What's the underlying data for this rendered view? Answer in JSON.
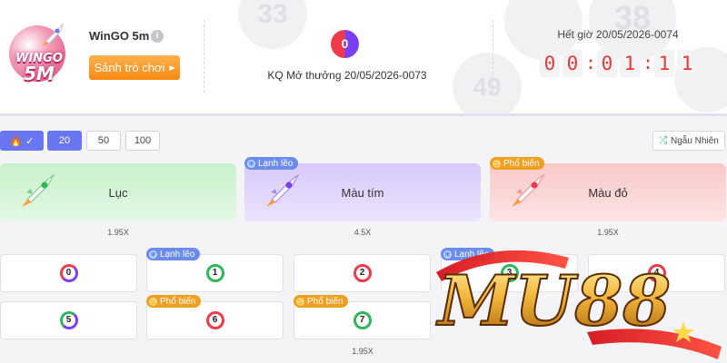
{
  "header": {
    "logo": {
      "line1": "WINGO",
      "line2": "5M"
    },
    "game_name": "WinGO 5m",
    "info_icon": "info-icon",
    "lobby_button": "Sảnh trò chơi",
    "last_result": {
      "number": "0",
      "label": "KQ Mở thưởng 20/05/2026-0073"
    },
    "deadline": {
      "label": "Hết giờ 20/05/2026-0074",
      "digits": [
        "0",
        "0",
        "0",
        "1",
        "1",
        "1"
      ],
      "separator": ":"
    },
    "watermark_balls": [
      "33",
      "38",
      "49"
    ]
  },
  "toolbar": {
    "multipliers": [
      "20",
      "50",
      "100"
    ],
    "selected": "20",
    "random_button": "Ngẫu Nhiên"
  },
  "color_bets": [
    {
      "label": "Lục",
      "odds": "1.95X",
      "tag": ""
    },
    {
      "label": "Màu tím",
      "odds": "4.5X",
      "tag": "Lạnh lẽo"
    },
    {
      "label": "Màu đỏ",
      "odds": "1.95X",
      "tag": "Phổ biến"
    }
  ],
  "numbers_row1": [
    {
      "n": "0",
      "tag": ""
    },
    {
      "n": "1",
      "tag": "Lạnh lẽo"
    },
    {
      "n": "2",
      "tag": ""
    },
    {
      "n": "3",
      "tag": "Lạnh lẽo"
    },
    {
      "n": "4",
      "tag": ""
    }
  ],
  "numbers_row2": [
    {
      "n": "5",
      "tag": ""
    },
    {
      "n": "6",
      "tag": "Phổ biến"
    },
    {
      "n": "7",
      "tag": "Phổ biến"
    }
  ],
  "number_odds": "1.95X",
  "watermark": "MU88",
  "colors": {
    "accent": "#6a76ef",
    "orange": "#f58a12",
    "red": "#ef3a4c",
    "green": "#2fb55a",
    "violet": "#7a3ef3",
    "timer": "#e23a3a"
  }
}
